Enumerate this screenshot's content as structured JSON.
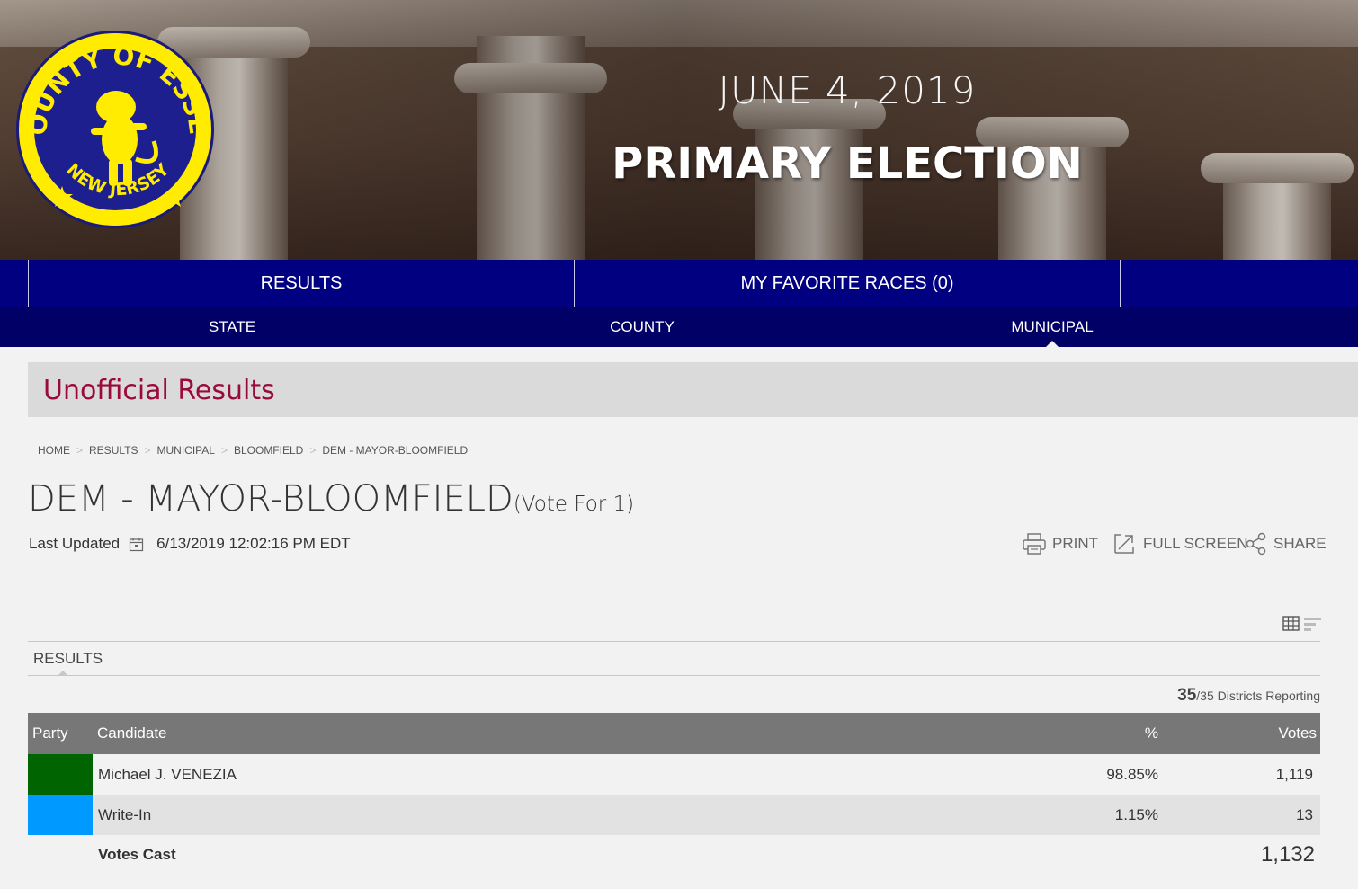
{
  "banner": {
    "date": "JUNE 4, 2019",
    "title": "PRIMARY ELECTION",
    "seal_top": "COUNTY OF ESSEX",
    "seal_bottom": "NEW JERSEY"
  },
  "nav": {
    "tabs": [
      {
        "label": "RESULTS"
      },
      {
        "label": "MY FAVORITE RACES  (0)"
      }
    ],
    "sub": [
      {
        "label": "STATE"
      },
      {
        "label": "COUNTY"
      },
      {
        "label": "MUNICIPAL",
        "active": true
      }
    ]
  },
  "section_heading": "Unofficial Results",
  "breadcrumb": [
    "HOME",
    "RESULTS",
    "MUNICIPAL",
    "BLOOMFIELD",
    "DEM - MAYOR-BLOOMFIELD"
  ],
  "race": {
    "title": "DEM - MAYOR-BLOOMFIELD",
    "vote_for": "(Vote For 1)",
    "last_updated_label": "Last Updated",
    "last_updated": "6/13/2019 12:02:16 PM EDT"
  },
  "actions": {
    "print": "PRINT",
    "full_screen": "FULL SCREEN",
    "share": "SHARE"
  },
  "results_tab": "RESULTS",
  "reporting": {
    "reported": "35",
    "total": "/35",
    "label": " Districts Reporting"
  },
  "table": {
    "headers": {
      "party": "Party",
      "candidate": "Candidate",
      "pct": "%",
      "votes": "Votes"
    },
    "rows": [
      {
        "candidate": "Michael J. VENEZIA",
        "pct": "98.85%",
        "votes": "1,119",
        "color": "#006400"
      },
      {
        "candidate": "Write-In",
        "pct": "1.15%",
        "votes": "13",
        "color": "#0099ff"
      }
    ],
    "total_label": "Votes Cast",
    "total_votes": "1,132"
  },
  "colors": {
    "nav_top": "#000080",
    "nav_sub": "#000066",
    "heading": "#9b0a3c",
    "seal_yellow": "#ffec00",
    "seal_blue": "#1d1f8f"
  }
}
